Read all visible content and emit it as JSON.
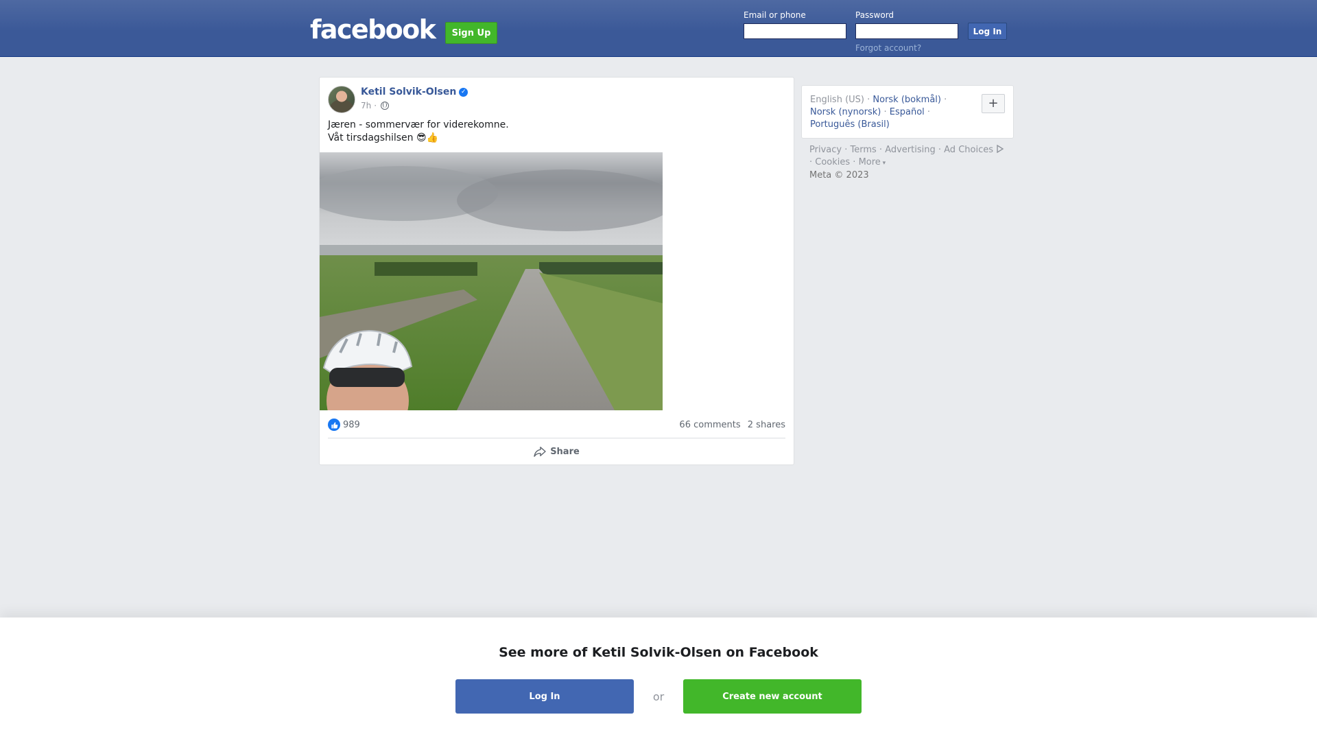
{
  "header": {
    "logo_text": "facebook",
    "signup_label": "Sign Up",
    "email_label": "Email or phone",
    "email_value": "",
    "password_label": "Password",
    "password_value": "",
    "login_label": "Log In",
    "forgot_label": "Forgot account?"
  },
  "post": {
    "author": "Ketil Solvik-Olsen",
    "verified": true,
    "time": "7h",
    "separator": "·",
    "audience_icon": "globe-icon",
    "text_line1": "Jæren - sommervær for viderekomne.",
    "text_line2": "Våt tirsdagshilsen 😎👍",
    "like_count": "989",
    "comments": "66 comments",
    "shares": "2 shares",
    "share_label": "Share"
  },
  "sidebar": {
    "languages": [
      {
        "label": "English (US)",
        "active": true
      },
      {
        "label": "Norsk (bokmål)",
        "active": false
      },
      {
        "label": "Norsk (nynorsk)",
        "active": false
      },
      {
        "label": "Español",
        "active": false
      },
      {
        "label": "Português (Brasil)",
        "active": false
      }
    ],
    "plus_label": "+",
    "footer_links": [
      "Privacy",
      "Terms",
      "Advertising",
      "Ad Choices",
      "Cookies",
      "More"
    ],
    "copyright": "Meta © 2023"
  },
  "banner": {
    "title": "See more of Ketil Solvik-Olsen on Facebook",
    "login_label": "Log In",
    "or_label": "or",
    "create_label": "Create new account"
  },
  "colors": {
    "header_blue": "#3b5998",
    "link_blue": "#385898",
    "green": "#42b72a",
    "login_blue": "#4267b2",
    "page_bg": "#e9ebee"
  }
}
